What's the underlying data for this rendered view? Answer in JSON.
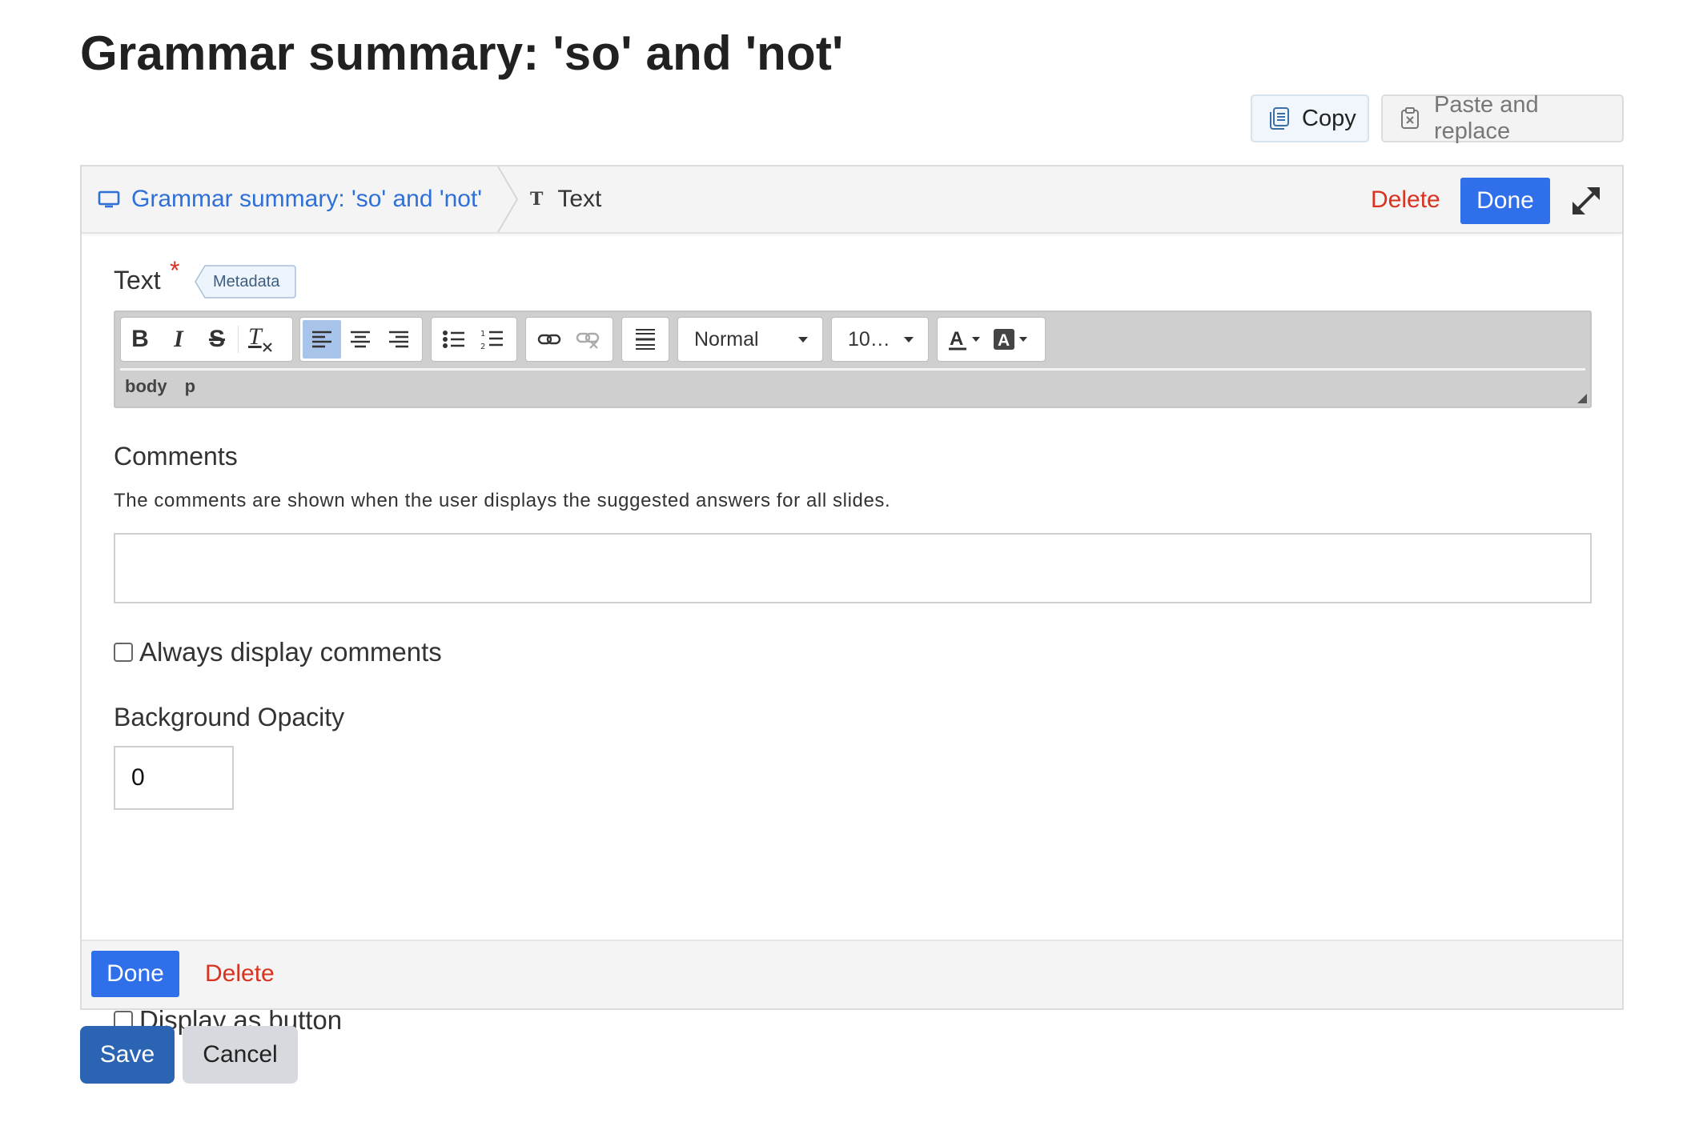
{
  "page": {
    "title": "Grammar summary: 'so' and 'not'"
  },
  "clipboard": {
    "copy_label": "Copy",
    "paste_label": "Paste and replace"
  },
  "editor": {
    "breadcrumb": {
      "home_label": "Grammar summary: 'so' and 'not'",
      "current_label": "Text",
      "current_icon_glyph": "T"
    },
    "header": {
      "delete_label": "Delete",
      "done_label": "Done"
    },
    "text_field": {
      "label": "Text",
      "required_mark": "*",
      "metadata_label": "Metadata",
      "toolbar": {
        "format_select": "Normal",
        "size_select": "10…",
        "bold_glyph": "B",
        "italic_glyph": "I",
        "strike_glyph": "S",
        "clear_format_glyph": "T"
      },
      "path": [
        "body",
        "p"
      ]
    },
    "comments": {
      "label": "Comments",
      "description": "The comments are shown when the user displays the suggested answers for all slides.",
      "value": ""
    },
    "always_display": {
      "label": "Always display comments",
      "checked": false
    },
    "opacity": {
      "label": "Background Opacity",
      "value": "0"
    },
    "display_button": {
      "label": "Display as button",
      "checked": false
    },
    "footer": {
      "done_label": "Done",
      "delete_label": "Delete"
    }
  },
  "actions": {
    "save_label": "Save",
    "cancel_label": "Cancel"
  },
  "colors": {
    "link": "#2f6fd8",
    "primary": "#2f6fea",
    "danger": "#d9321f",
    "save": "#2a64b3"
  }
}
